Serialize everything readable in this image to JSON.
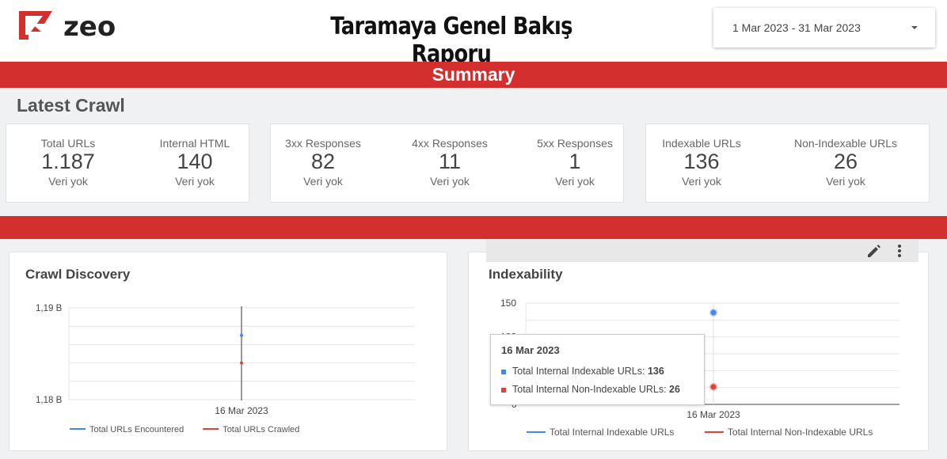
{
  "header": {
    "logo_text": "zeo",
    "title": "Taramaya Genel Bakış Raporu",
    "date_range": "1 Mar 2023 - 31 Mar 2023"
  },
  "summary_band": {
    "title": "Summary"
  },
  "section": {
    "title": "Latest Crawl"
  },
  "kpis": [
    {
      "label": "Total URLs",
      "value": "1.187",
      "sub": "Veri yok"
    },
    {
      "label": "Internal HTML",
      "value": "140",
      "sub": "Veri yok"
    },
    {
      "label": "3xx Responses",
      "value": "82",
      "sub": "Veri yok"
    },
    {
      "label": "4xx Responses",
      "value": "11",
      "sub": "Veri yok"
    },
    {
      "label": "5xx Responses",
      "value": "1",
      "sub": "Veri yok"
    },
    {
      "label": "Indexable URLs",
      "value": "136",
      "sub": "Veri yok"
    },
    {
      "label": "Non-Indexable URLs",
      "value": "26",
      "sub": "Veri yok"
    }
  ],
  "colors": {
    "brand_red": "#d32f2f",
    "series_blue": "#4285f4",
    "series_red": "#db4437"
  },
  "icons": {
    "edit": "pencil-icon",
    "more": "more-vert-icon",
    "dropdown": "caret-down-icon"
  },
  "chart_data": [
    {
      "type": "line",
      "title": "Crawl Discovery",
      "x": [
        "16 Mar 2023"
      ],
      "y_tick_labels": [
        "1,19 B",
        "1,18 B"
      ],
      "ylim": [
        1180,
        1190
      ],
      "grid": true,
      "legend_position": "bottom",
      "series": [
        {
          "name": "Total URLs Encountered",
          "values": [
            1187
          ],
          "color": "#4285f4"
        },
        {
          "name": "Total URLs Crawled",
          "values": [
            1184
          ],
          "color": "#db4437"
        }
      ]
    },
    {
      "type": "line",
      "title": "Indexability",
      "x": [
        "16 Mar 2023"
      ],
      "y_tick_labels": [
        "150",
        "100",
        "0"
      ],
      "ylim": [
        0,
        150
      ],
      "grid": true,
      "legend_position": "bottom",
      "series": [
        {
          "name": "Total Internal Indexable URLs",
          "values": [
            136
          ],
          "color": "#4285f4"
        },
        {
          "name": "Total Internal Non-Indexable URLs",
          "values": [
            26
          ],
          "color": "#db4437"
        }
      ],
      "tooltip": {
        "date": "16 Mar 2023",
        "rows": [
          {
            "label": "Total Internal Indexable URLs:",
            "value": "136"
          },
          {
            "label": "Total Internal Non-Indexable URLs:",
            "value": "26"
          }
        ]
      }
    }
  ]
}
